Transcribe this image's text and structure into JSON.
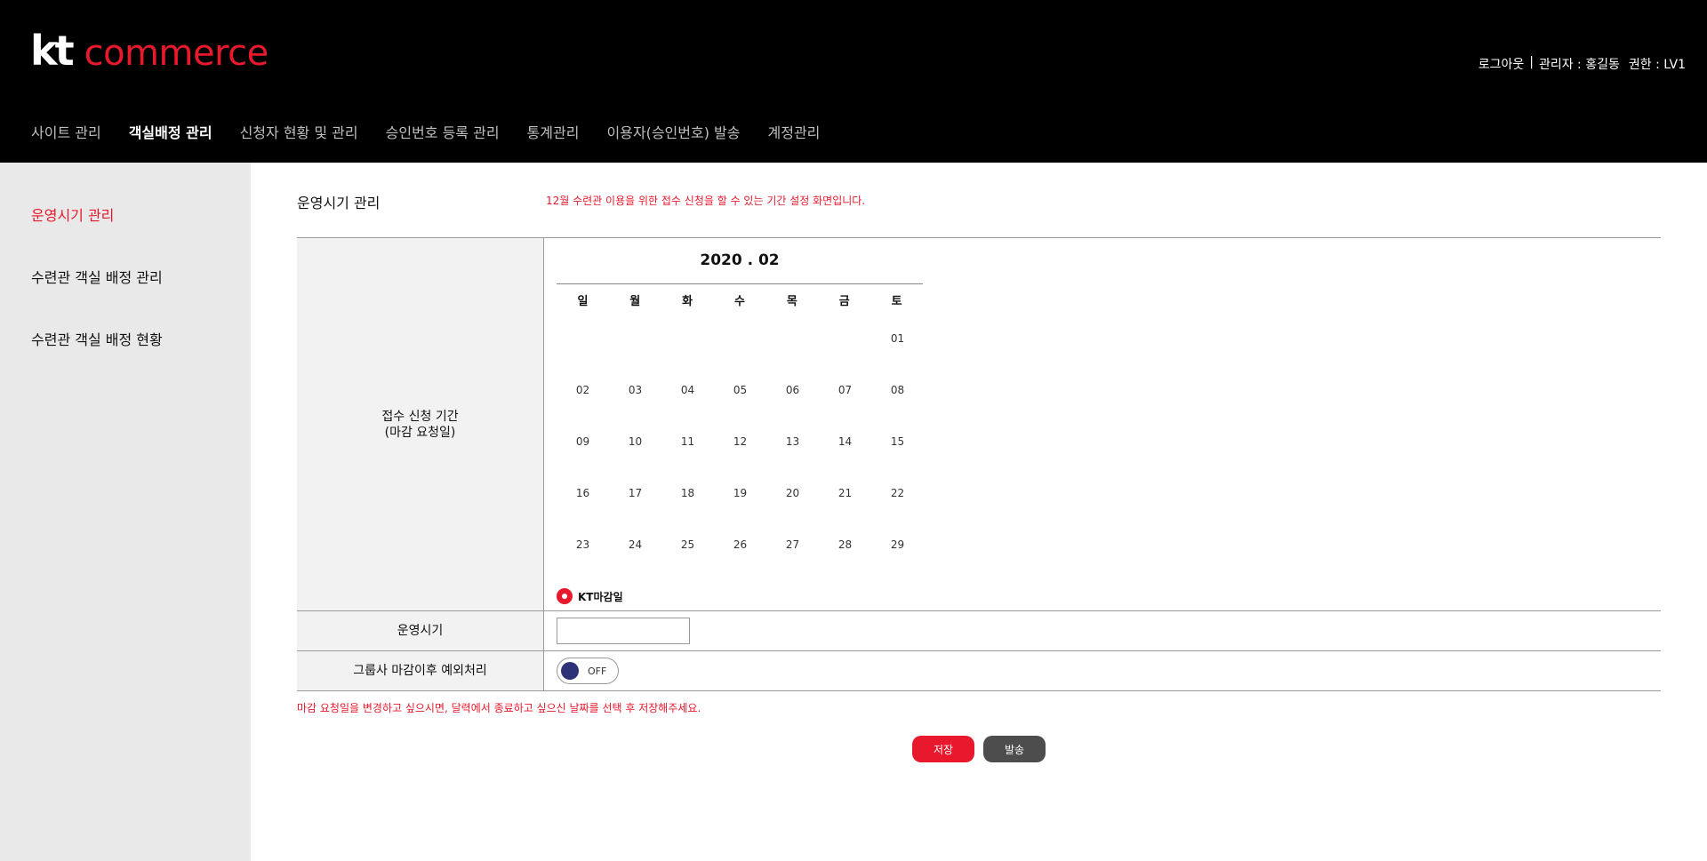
{
  "brand": {
    "kt": "kt",
    "commerce": "commerce",
    "accent_color": "#e8192c"
  },
  "header": {
    "logout": "로그아웃",
    "separator": "|",
    "admin_label": "관리자 : 홍길동",
    "permission_label": "권한 : LV1"
  },
  "gnb": {
    "items": [
      {
        "label": "사이트 관리"
      },
      {
        "label": "객실배정 관리"
      },
      {
        "label": "신청자 현황 및 관리"
      },
      {
        "label": "승인번호 등록 관리"
      },
      {
        "label": "통계관리"
      },
      {
        "label": "이용자(승인번호) 발송"
      },
      {
        "label": "계정관리"
      }
    ],
    "active_index": 1
  },
  "sidebar": {
    "items": [
      {
        "label": "운영시기 관리"
      },
      {
        "label": "수련관 객실 배정 관리"
      },
      {
        "label": "수련관 객실 배정 현황"
      }
    ],
    "active_index": 0
  },
  "main": {
    "title": "운영시기 관리",
    "description": "12월 수련관 이용을 위한 접수 신청을 할 수 있는 기간 설정 화면입니다.",
    "period_label_line1": "접수 신청 기간",
    "period_label_line2": "(마감 요청일)",
    "operation_label": "운영시기",
    "operation_value": "",
    "exception_label": "그룹사 마감이후 예외처리",
    "toggle_state": "OFF",
    "notice": "마감 요청일을 변경하고 싶으시면, 달력에서 종료하고 싶으신 날짜를 선택 후 저장해주세요.",
    "save_button": "저장",
    "send_button": "발송"
  },
  "calendar": {
    "title": "2020 . 02",
    "weekdays": [
      "일",
      "월",
      "화",
      "수",
      "목",
      "금",
      "토"
    ],
    "weeks": [
      [
        "",
        "",
        "",
        "",
        "",
        "",
        "01"
      ],
      [
        "02",
        "03",
        "04",
        "05",
        "06",
        "07",
        "08"
      ],
      [
        "09",
        "10",
        "11",
        "12",
        "13",
        "14",
        "15"
      ],
      [
        "16",
        "17",
        "18",
        "19",
        "20",
        "21",
        "22"
      ],
      [
        "23",
        "24",
        "25",
        "26",
        "27",
        "28",
        "29"
      ]
    ],
    "legend_label": "KT마감일"
  }
}
